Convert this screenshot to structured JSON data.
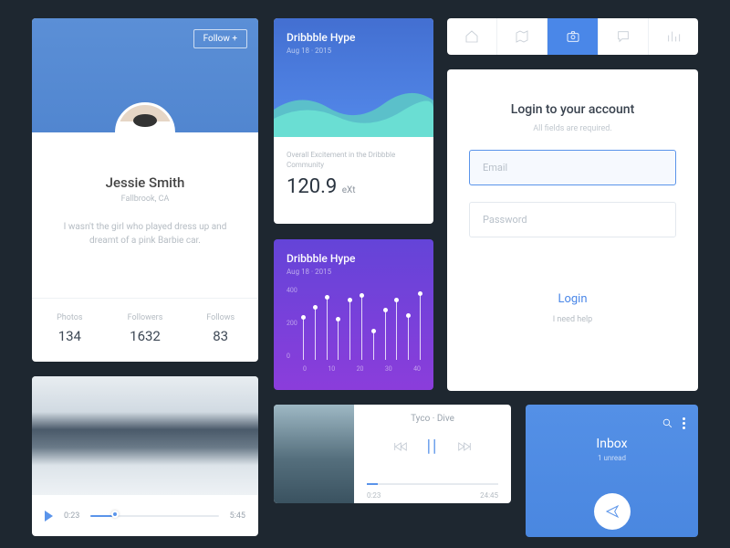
{
  "profile": {
    "follow_label": "Follow +",
    "name": "Jessie Smith",
    "location": "Fallbrook, CA",
    "bio": "I wasn't the girl who played dress up and dreamt of a pink Barbie car.",
    "stats": {
      "photos_label": "Photos",
      "photos": "134",
      "followers_label": "Followers",
      "followers": "1632",
      "follows_label": "Follows",
      "follows": "83"
    }
  },
  "hype_wave": {
    "title": "Dribbble Hype",
    "date": "Aug 18 · 2015",
    "subtitle": "Overall Excitement in the Dribbble Community",
    "value": "120.9",
    "unit": "eXt"
  },
  "hype_bars": {
    "title": "Dribbble Hype",
    "date": "Aug 18 · 2015"
  },
  "login": {
    "title": "Login to your account",
    "hint": "All fields are required.",
    "email_placeholder": "Email",
    "password_placeholder": "Password",
    "login_label": "Login",
    "help_label": "I need help"
  },
  "video": {
    "t1": "0:23",
    "t2": "5:45",
    "progress_pct": 18
  },
  "music": {
    "track": "Tyco · Dive",
    "t1": "0:23",
    "t2": "24:45"
  },
  "inbox": {
    "title": "Inbox",
    "unread": "1 unread"
  },
  "chart_data": {
    "type": "bar",
    "title": "Dribbble Hype",
    "ylim": [
      0,
      400
    ],
    "yticks": [
      0,
      200,
      400
    ],
    "xticks": [
      0,
      10,
      20,
      30,
      40
    ],
    "values": [
      250,
      310,
      370,
      240,
      350,
      380,
      170,
      290,
      350,
      260,
      390
    ]
  }
}
